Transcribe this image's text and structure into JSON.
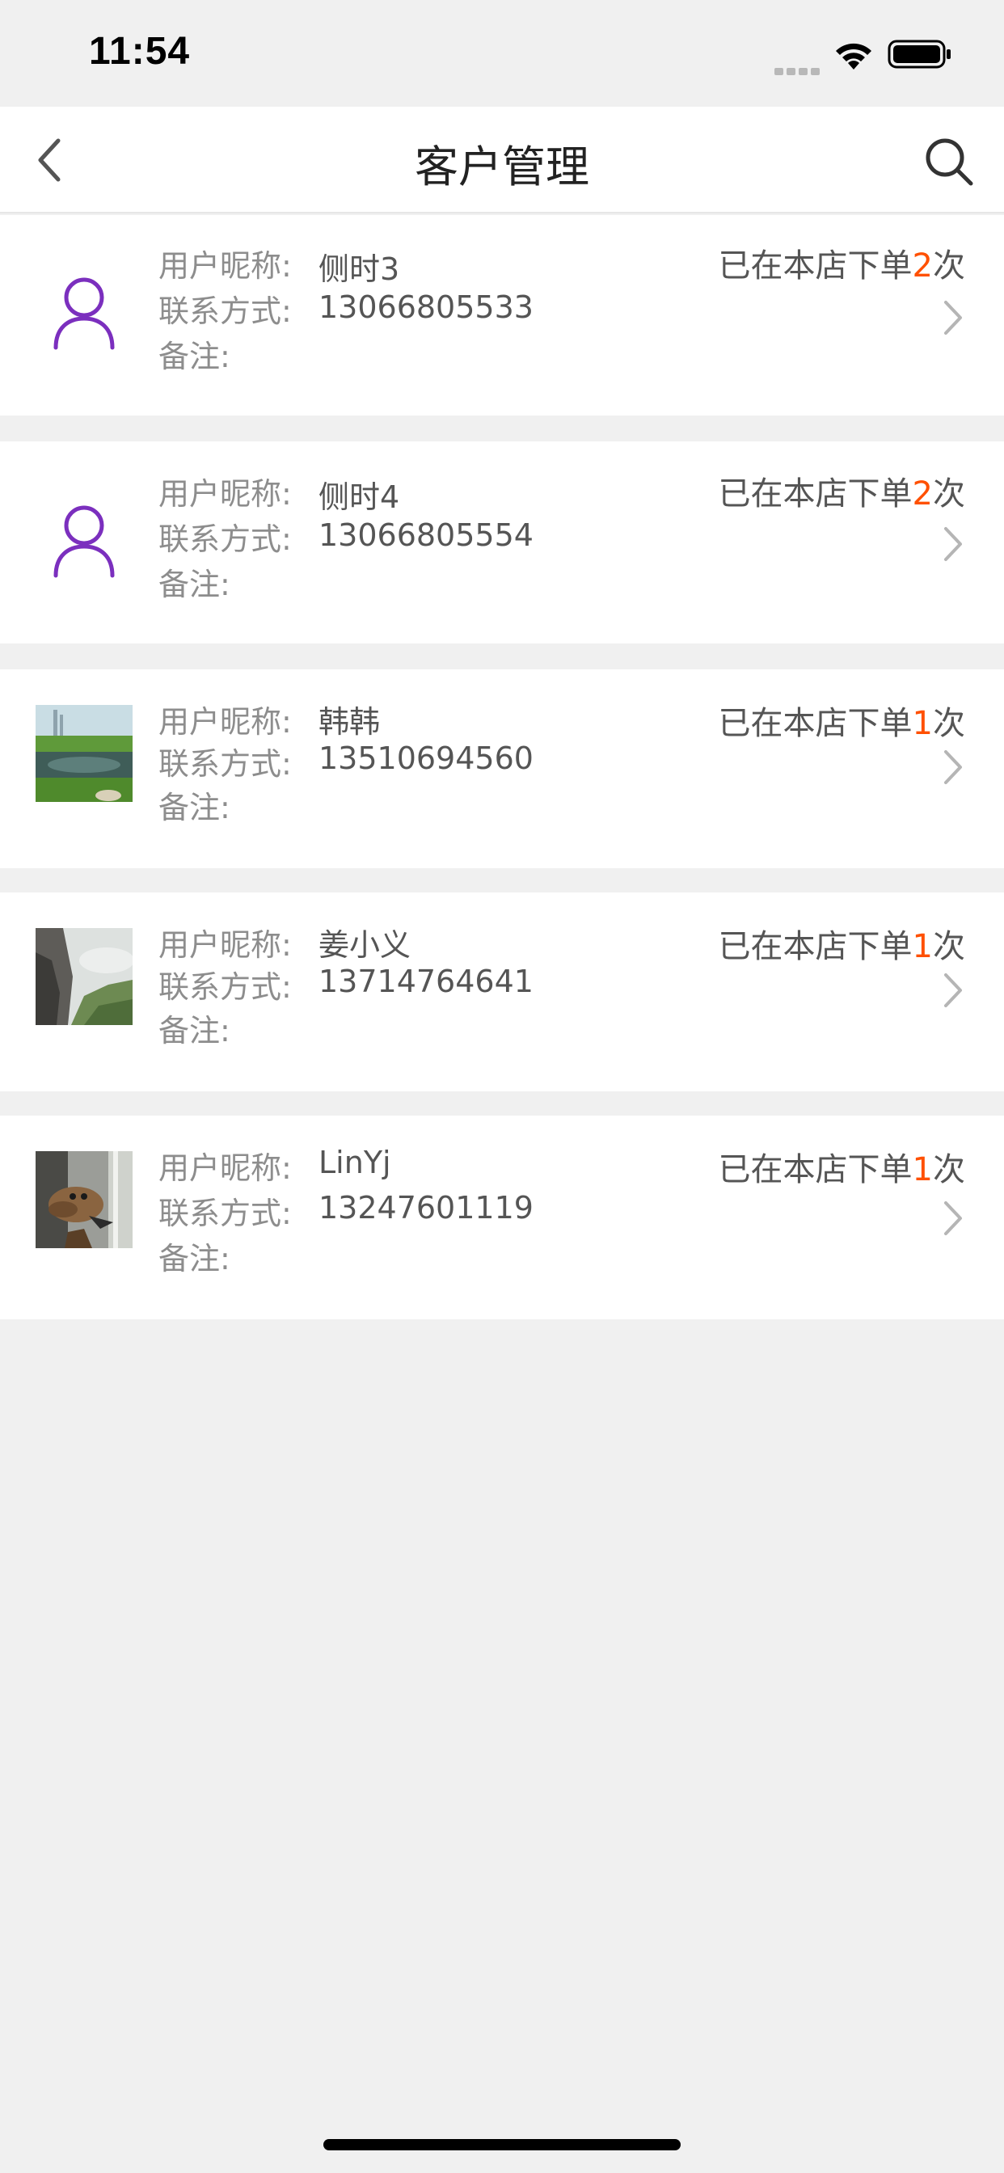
{
  "status_bar": {
    "time": "11:54"
  },
  "nav": {
    "title": "客户管理"
  },
  "labels": {
    "nickname": "用户昵称:",
    "contact": "联系方式:",
    "remark": "备注:"
  },
  "orders_text": {
    "prefix": "已在本店下单",
    "suffix": "次"
  },
  "colors": {
    "accent": "#ff5000",
    "avatar_icon": "#7b2fbe",
    "background": "#f0f0f0"
  },
  "customers": [
    {
      "avatar": "default-user-icon",
      "nickname": "侧时3",
      "phone": "13066805533",
      "remark": "",
      "order_count": "2"
    },
    {
      "avatar": "default-user-icon",
      "nickname": "侧时4",
      "phone": "13066805554",
      "remark": "",
      "order_count": "2"
    },
    {
      "avatar": "photo-lake",
      "nickname": "韩韩",
      "phone": "13510694560",
      "remark": "",
      "order_count": "1"
    },
    {
      "avatar": "photo-mountain",
      "nickname": "姜小义",
      "phone": "13714764641",
      "remark": "",
      "order_count": "1"
    },
    {
      "avatar": "photo-camel-toy",
      "nickname": "LinYj",
      "phone": "13247601119",
      "remark": "",
      "order_count": "1"
    }
  ]
}
